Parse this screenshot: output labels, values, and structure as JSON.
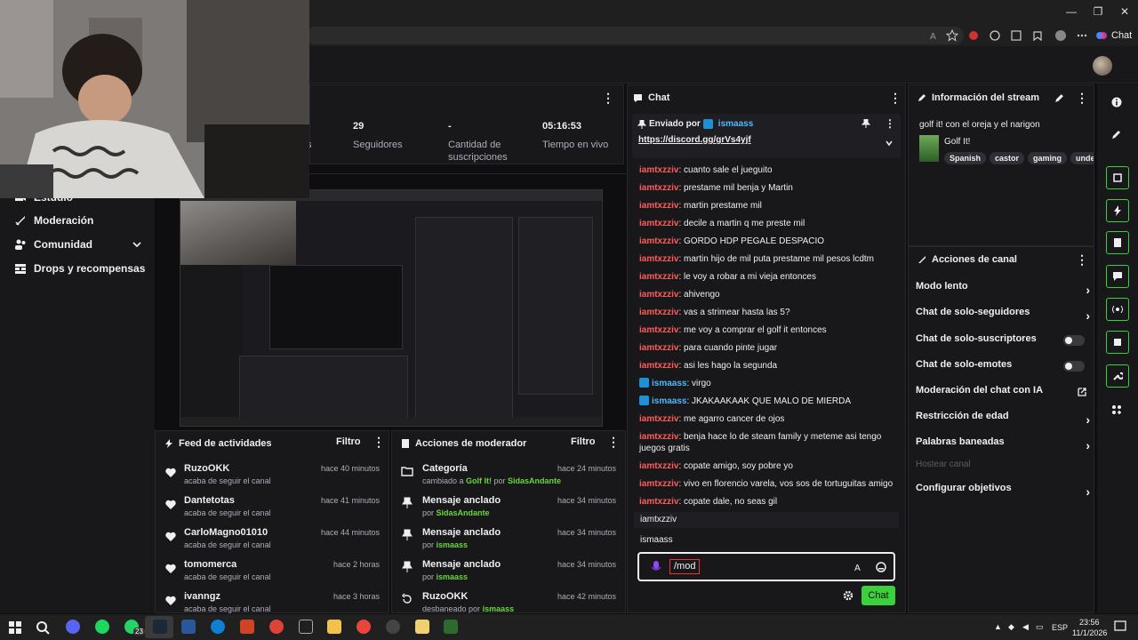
{
  "browser": {
    "copilot_label": "Chat"
  },
  "sidebar": {
    "items": [
      {
        "label": "Estudio",
        "icon": "camera-icon"
      },
      {
        "label": "Moderación",
        "icon": "sword-icon"
      },
      {
        "label": "Comunidad",
        "icon": "people-icon"
      },
      {
        "label": "Drops y recompensas",
        "icon": "gift-icon"
      }
    ]
  },
  "stats": {
    "followers_value": "29",
    "followers_label": "Seguidores",
    "subs_value": "-",
    "subs_label": "Cantidad de suscripciones",
    "live_value": "05:16:53",
    "live_label": "Tiempo en vivo",
    "partial_label": "s"
  },
  "activity_feed": {
    "title": "Feed de actividades",
    "filter": "Filtro",
    "items": [
      {
        "name": "RuzoOKK",
        "sub": "acaba de seguir el canal",
        "time": "hace 40 minutos"
      },
      {
        "name": "Dantetotas",
        "sub": "acaba de seguir el canal",
        "time": "hace 41 minutos"
      },
      {
        "name": "CarloMagno01010",
        "sub": "acaba de seguir el canal",
        "time": "hace 44 minutos"
      },
      {
        "name": "tomomerca",
        "sub": "acaba de seguir el canal",
        "time": "hace 2 horas"
      },
      {
        "name": "ivanngz",
        "sub": "acaba de seguir el canal",
        "time": "hace 3 horas"
      }
    ]
  },
  "mod_actions": {
    "title": "Acciones de moderador",
    "filter": "Filtro",
    "items": [
      {
        "title": "Categoría",
        "sub_pre": "cambiado a ",
        "sub_hl": "Golf It!",
        "sub_mid": " por ",
        "sub_user": "SidasAndante",
        "time": "hace 24 minutos",
        "icon": "category-icon"
      },
      {
        "title": "Mensaje anclado",
        "sub_pre": "por ",
        "sub_hl": "",
        "sub_mid": "",
        "sub_user": "SidasAndante",
        "time": "hace 34 minutos",
        "icon": "pin-icon"
      },
      {
        "title": "Mensaje anclado",
        "sub_pre": "por ",
        "sub_hl": "",
        "sub_mid": "",
        "sub_user": "ismaass",
        "time": "hace 34 minutos",
        "icon": "pin-icon"
      },
      {
        "title": "Mensaje anclado",
        "sub_pre": "por ",
        "sub_hl": "",
        "sub_mid": "",
        "sub_user": "ismaass",
        "time": "hace 34 minutos",
        "icon": "pin-icon"
      },
      {
        "title": "RuzoOKK",
        "sub_pre": "desbaneado por ",
        "sub_hl": "",
        "sub_mid": "",
        "sub_user": "ismaass",
        "time": "hace 42 minutos",
        "icon": "undo-icon"
      }
    ]
  },
  "chat": {
    "title": "Chat",
    "pinned_sender_prefix": "Enviado por",
    "pinned_sender": "ismaass",
    "pinned_link": "https://discord.gg/grVs4yjf",
    "messages": [
      {
        "user": "iamtxzziv",
        "text": "cuanto sale el jueguito",
        "type": "red"
      },
      {
        "user": "iamtxzziv",
        "text": "prestame mil benja y Martin",
        "type": "red"
      },
      {
        "user": "iamtxzziv",
        "text": "martin prestame mil",
        "type": "red"
      },
      {
        "user": "iamtxzziv",
        "text": "decile a martin q me preste mil",
        "type": "red"
      },
      {
        "user": "iamtxzziv",
        "text": "GORDO HDP PEGALE DESPACIO",
        "type": "red"
      },
      {
        "user": "iamtxzziv",
        "text": "martin hijo de mil puta prestame mil pesos lcdtm",
        "type": "red"
      },
      {
        "user": "iamtxzziv",
        "text": "le voy a robar a mi vieja entonces",
        "type": "red"
      },
      {
        "user": "iamtxzziv",
        "text": "ahivengo",
        "type": "red"
      },
      {
        "user": "iamtxzziv",
        "text": "vas a strimear hasta las 5?",
        "type": "red"
      },
      {
        "user": "iamtxzziv",
        "text": "me voy a comprar el golf it entonces",
        "type": "red"
      },
      {
        "user": "iamtxzziv",
        "text": "para cuando pinte jugar",
        "type": "red"
      },
      {
        "user": "iamtxzziv",
        "text": "asi les hago la segunda",
        "type": "red"
      },
      {
        "user": "ismaass",
        "text": "virgo",
        "type": "blue"
      },
      {
        "user": "ismaass",
        "text": "JKAKAAKAAK QUE MALO DE MIERDA",
        "type": "blue"
      },
      {
        "user": "iamtxzziv",
        "text": "me agarro cancer de ojos",
        "type": "red"
      },
      {
        "user": "iamtxzziv",
        "text": "benja hace lo de steam family y meteme asi tengo juegos gratis",
        "type": "red"
      },
      {
        "user": "iamtxzziv",
        "text": "copate amigo, soy pobre yo",
        "type": "red"
      },
      {
        "user": "iamtxzziv",
        "text": "vivo en florencio varela, vos sos de tortuguitas amigo",
        "type": "red"
      },
      {
        "user": "iamtxzziv",
        "text": "copate dale, no seas gil",
        "type": "red"
      }
    ],
    "suggestions": [
      "iamtxzziv",
      "ismaass"
    ],
    "input_value": "/mod",
    "send_label": "Chat"
  },
  "stream_info": {
    "title": "Información del stream",
    "stream_title": "golf it! con el oreja y el narigon",
    "category": "Golf It!",
    "tags": [
      "Spanish",
      "castor",
      "gaming",
      "under"
    ]
  },
  "channel_actions": {
    "title": "Acciones de canal",
    "items": [
      {
        "label": "Modo lento",
        "control": "chevron"
      },
      {
        "label": "Chat de solo-seguidores",
        "control": "chevron"
      },
      {
        "label": "Chat de solo-suscriptores",
        "control": "toggle"
      },
      {
        "label": "Chat de solo-emotes",
        "control": "toggle"
      },
      {
        "label": "Moderación del chat con IA",
        "control": "external"
      },
      {
        "label": "Restricción de edad",
        "control": "chevron"
      },
      {
        "label": "Palabras baneadas",
        "control": "chevron"
      },
      {
        "label": "Hostear canal",
        "control": "none"
      },
      {
        "label": "Configurar objetivos",
        "control": "chevron"
      }
    ]
  },
  "taskbar": {
    "lang": "ESP",
    "time": "23:56",
    "date": "11/1/2026",
    "whatsapp_badge": "23"
  },
  "colors": {
    "accent_green": "#3dd03d",
    "username_red": "#ff5c5c",
    "username_blue": "#4fb8ff",
    "bg": "#0e0e10",
    "panel": "#18181b"
  }
}
